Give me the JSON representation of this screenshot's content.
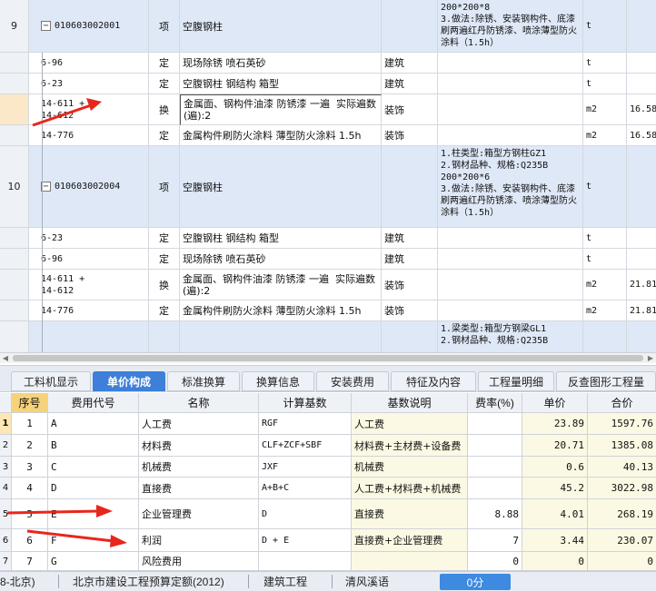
{
  "top_grid": {
    "rows": [
      {
        "kind": "item",
        "num": "9",
        "code": "010603002001",
        "type": "项",
        "name": "空腹钢柱",
        "spec": "",
        "feature": "200*200*8\n3.做法:除锈、安装钢构件、底漆刷两遍红丹防锈漆、喷涂薄型防火涂料（1.5h）",
        "unit": "t",
        "qty": ""
      },
      {
        "kind": "sub",
        "num": "",
        "code": "6-96",
        "type": "定",
        "name": "现场除锈 喷石英砂",
        "spec": "建筑",
        "feature": "",
        "unit": "t",
        "qty": ""
      },
      {
        "kind": "sub",
        "num": "",
        "code": "6-23",
        "type": "定",
        "name": "空腹钢柱 钢结构 箱型",
        "spec": "建筑",
        "feature": "",
        "unit": "t",
        "qty": ""
      },
      {
        "kind": "sub",
        "num": "",
        "code": "14-611 +\n14-612",
        "type": "换",
        "name": "金属面、钢构件油漆 防锈漆 一遍  实际遍数(遍):2",
        "spec": "装饰",
        "feature": "",
        "unit": "m2",
        "qty": "16.58"
      },
      {
        "kind": "sub",
        "num": "",
        "code": "14-776",
        "type": "定",
        "name": "金属构件刷防火涂料 薄型防火涂料 1.5h",
        "spec": "装饰",
        "feature": "",
        "unit": "m2",
        "qty": "16.58"
      },
      {
        "kind": "item",
        "num": "10",
        "code": "010603002004",
        "type": "项",
        "name": "空腹钢柱",
        "spec": "",
        "feature": "1.柱类型:箱型方钢柱GZ1\n2.钢材品种、规格:Q235B\n200*200*6\n3.做法:除锈、安装钢构件、底漆刷两遍红丹防锈漆、喷涂薄型防火涂料（1.5h）",
        "unit": "t",
        "qty": ""
      },
      {
        "kind": "sub",
        "num": "",
        "code": "6-23",
        "type": "定",
        "name": "空腹钢柱 钢结构 箱型",
        "spec": "建筑",
        "feature": "",
        "unit": "t",
        "qty": ""
      },
      {
        "kind": "sub",
        "num": "",
        "code": "6-96",
        "type": "定",
        "name": "现场除锈 喷石英砂",
        "spec": "建筑",
        "feature": "",
        "unit": "t",
        "qty": ""
      },
      {
        "kind": "sub",
        "num": "",
        "code": "14-611 +\n14-612",
        "type": "换",
        "name": "金属面、钢构件油漆 防锈漆 一遍  实际遍数(遍):2",
        "spec": "装饰",
        "feature": "",
        "unit": "m2",
        "qty": "21.81"
      },
      {
        "kind": "sub",
        "num": "",
        "code": "14-776",
        "type": "定",
        "name": "金属构件刷防火涂料 薄型防火涂料 1.5h",
        "spec": "装饰",
        "feature": "",
        "unit": "m2",
        "qty": "21.81"
      },
      {
        "kind": "item",
        "num": "",
        "code": "",
        "type": "",
        "name": "",
        "spec": "",
        "feature": "1.梁类型:箱型方钢梁GL1\n2.钢材品种、规格:Q235B",
        "unit": "",
        "qty": ""
      }
    ]
  },
  "tabs": [
    {
      "label": "工料机显示",
      "active": false
    },
    {
      "label": "单价构成",
      "active": true
    },
    {
      "label": "标准换算",
      "active": false
    },
    {
      "label": "换算信息",
      "active": false
    },
    {
      "label": "安装费用",
      "active": false
    },
    {
      "label": "特征及内容",
      "active": false
    },
    {
      "label": "工程量明细",
      "active": false
    },
    {
      "label": "反查图形工程量",
      "active": false
    }
  ],
  "price_table": {
    "headers": {
      "seq": "序号",
      "code": "费用代号",
      "name": "名称",
      "base": "计算基数",
      "desc": "基数说明",
      "rate": "费率(%)",
      "unit": "单价",
      "total": "合价"
    },
    "rows": [
      {
        "idx": "1",
        "seq": "1",
        "code": "A",
        "name": "人工费",
        "base": "RGF",
        "desc": "人工费",
        "rate": "",
        "unit": "23.89",
        "total": "1597.76"
      },
      {
        "idx": "2",
        "seq": "2",
        "code": "B",
        "name": "材料费",
        "base": "CLF+ZCF+SBF",
        "desc": "材料费+主材费+设备费",
        "rate": "",
        "unit": "20.71",
        "total": "1385.08"
      },
      {
        "idx": "3",
        "seq": "3",
        "code": "C",
        "name": "机械费",
        "base": "JXF",
        "desc": "机械费",
        "rate": "",
        "unit": "0.6",
        "total": "40.13"
      },
      {
        "idx": "4",
        "seq": "4",
        "code": "D",
        "name": "直接费",
        "base": "A+B+C",
        "desc": "人工费+材料费+机械费",
        "rate": "",
        "unit": "45.2",
        "total": "3022.98"
      },
      {
        "idx": "5",
        "seq": "5",
        "code": "E",
        "name": "企业管理费",
        "base": "D",
        "desc": "直接费",
        "rate": "8.88",
        "unit": "4.01",
        "total": "268.19"
      },
      {
        "idx": "6",
        "seq": "6",
        "code": "F",
        "name": "利润",
        "base": "D + E",
        "desc": "直接费+企业管理费",
        "rate": "7",
        "unit": "3.44",
        "total": "230.07"
      },
      {
        "idx": "7",
        "seq": "7",
        "code": "G",
        "name": "风险费用",
        "base": "",
        "desc": "",
        "rate": "0",
        "unit": "0",
        "total": "0"
      }
    ]
  },
  "status_bar": {
    "region": "8-北京)",
    "quota": "北京市建设工程预算定额(2012)",
    "discipline": "建筑工程",
    "theme": "清风溪语",
    "score": "0分"
  },
  "colors": {
    "accent": "#3d7fd9",
    "item_row": "#dfe8f7",
    "annotation": "#e8261c"
  }
}
